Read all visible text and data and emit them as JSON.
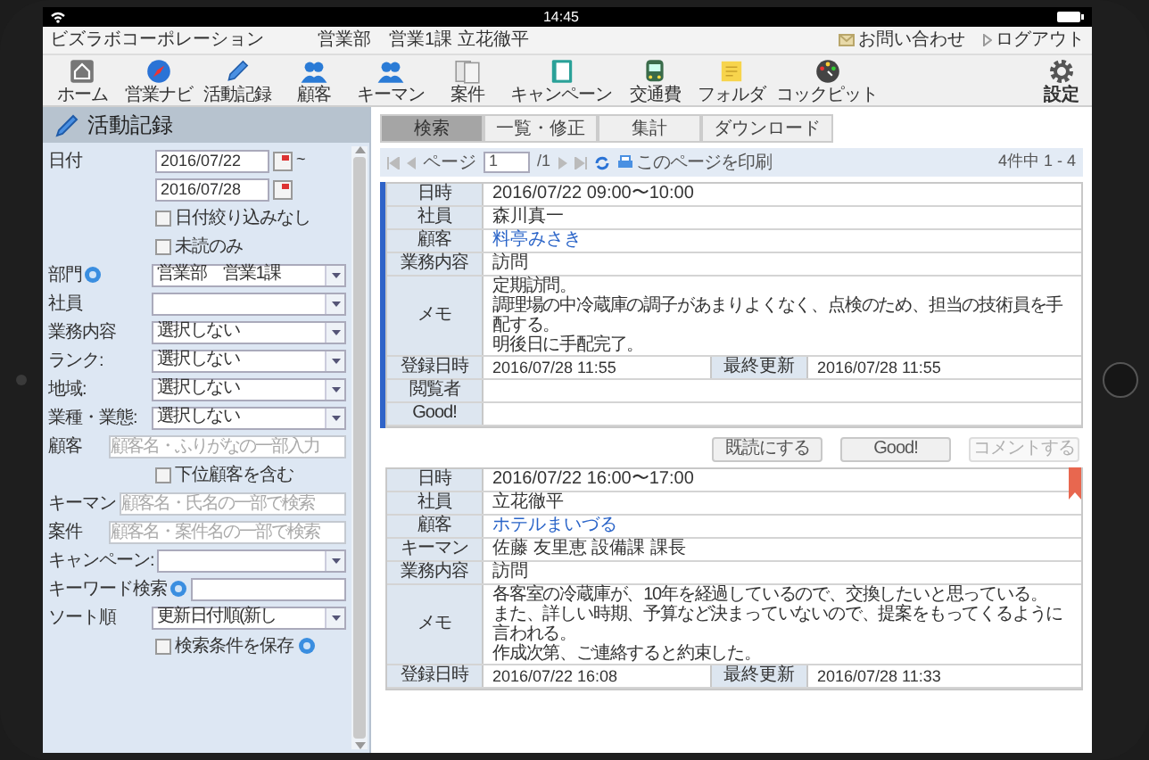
{
  "status_bar": {
    "time": "14:45"
  },
  "header": {
    "company": "ビズラボコーポレーション",
    "user": "営業部　営業1課 立花徹平",
    "links": [
      {
        "label": "お問い合わせ",
        "kind": "mail"
      },
      {
        "label": "ログアウト",
        "kind": "logout"
      }
    ]
  },
  "toolbar": {
    "items": [
      {
        "label": "ホーム"
      },
      {
        "label": "営業ナビ"
      },
      {
        "label": "活動記録"
      },
      {
        "label": "顧客"
      },
      {
        "label": "キーマン"
      },
      {
        "label": "案件"
      },
      {
        "label": "キャンペーン"
      },
      {
        "label": "交通費"
      },
      {
        "label": "フォルダ"
      },
      {
        "label": "コックピット"
      }
    ],
    "settings": "設定"
  },
  "sidebar": {
    "title": "活動記録",
    "fields": [
      {
        "kind": "date",
        "label": "日付",
        "value": "2016/07/22",
        "suffix": "~"
      },
      {
        "kind": "date",
        "value": "2016/07/28"
      },
      {
        "kind": "checkbox",
        "label": "日付絞り込みなし",
        "checked": false
      },
      {
        "kind": "checkbox",
        "label": "未読のみ",
        "checked": false
      },
      {
        "kind": "select",
        "label": "部門",
        "help": true,
        "value": "営業部　営業1課"
      },
      {
        "kind": "select",
        "label": "社員"
      },
      {
        "kind": "select",
        "label": "業務内容",
        "value": "選択しない"
      },
      {
        "kind": "select",
        "label": "ランク:",
        "value": "選択しない"
      },
      {
        "kind": "select",
        "label": "地域:",
        "value": "選択しない"
      },
      {
        "kind": "select",
        "label": "業種・業態:",
        "value": "選択しない"
      },
      {
        "kind": "text",
        "label": "顧客",
        "placeholder": "顧客名・ふりがなの一部入力"
      },
      {
        "kind": "checkbox",
        "label": "下位顧客を含む",
        "checked": false
      },
      {
        "kind": "text",
        "label": "キーマン",
        "placeholder": "顧客名・氏名の一部で検索"
      },
      {
        "kind": "text",
        "label": "案件",
        "placeholder": "顧客名・案件名の一部で検索"
      },
      {
        "kind": "select",
        "label": "キャンペーン:"
      },
      {
        "kind": "input",
        "label": "キーワード検索",
        "help": true
      },
      {
        "kind": "select",
        "label": "ソート順",
        "value": "更新日付順(新し"
      },
      {
        "kind": "checkbox",
        "label": "検索条件を保存",
        "checked": false,
        "help": true
      }
    ]
  },
  "tabs": [
    {
      "label": "検索",
      "selected": true
    },
    {
      "label": "一覧・修正",
      "selected": false
    },
    {
      "label": "集計",
      "selected": false
    },
    {
      "label": "ダウンロード",
      "selected": false
    }
  ],
  "pager": {
    "page_label": "ページ",
    "page": "1",
    "total": "/1",
    "print": "このページを印刷",
    "count": "4件中 1 - 4"
  },
  "records": [
    {
      "selected": true,
      "bookmarked": false,
      "rows": [
        {
          "kind": "text",
          "label": "日時",
          "value": "2016/07/22 09:00〜10:00"
        },
        {
          "kind": "text",
          "label": "社員",
          "value": "森川真一"
        },
        {
          "kind": "link",
          "label": "顧客",
          "value": "料亭みさき"
        },
        {
          "kind": "text",
          "label": "業務内容",
          "value": "訪問"
        },
        {
          "kind": "memo",
          "label": "メモ",
          "lines": [
            "定期訪問。",
            "調理場の中冷蔵庫の調子があまりよくなく、点検のため、担当の技術員を手配する。",
            "明後日に手配完了。"
          ]
        },
        {
          "kind": "split",
          "label": "登録日時",
          "value": "2016/07/28 11:55",
          "label_2": "最終更新",
          "value_2": "2016/07/28 11:55"
        },
        {
          "kind": "empty",
          "label": "閲覧者"
        },
        {
          "kind": "empty",
          "label": "Good!"
        }
      ],
      "buttons": [
        {
          "label": "既読にする",
          "disabled": false
        },
        {
          "label": "Good!",
          "disabled": false
        },
        {
          "label": "コメントする",
          "disabled": true
        }
      ]
    },
    {
      "selected": false,
      "bookmarked": true,
      "rows": [
        {
          "kind": "text",
          "label": "日時",
          "value": "2016/07/22 16:00〜17:00"
        },
        {
          "kind": "text",
          "label": "社員",
          "value": "立花徹平"
        },
        {
          "kind": "link",
          "label": "顧客",
          "value": "ホテルまいづる"
        },
        {
          "kind": "text",
          "label": "キーマン",
          "value": "佐藤 友里恵 設備課 課長"
        },
        {
          "kind": "text",
          "label": "業務内容",
          "value": "訪問"
        },
        {
          "kind": "memo",
          "label": "メモ",
          "lines": [
            "各客室の冷蔵庫が、10年を経過しているので、交換したいと思っている。",
            "また、詳しい時期、予算など決まっていないので、提案をもってくるように言われる。",
            "作成次第、ご連絡すると約束した。"
          ]
        },
        {
          "kind": "split",
          "label": "登録日時",
          "value": "2016/07/22 16:08",
          "label_2": "最終更新",
          "value_2": "2016/07/28 11:33"
        }
      ]
    }
  ]
}
